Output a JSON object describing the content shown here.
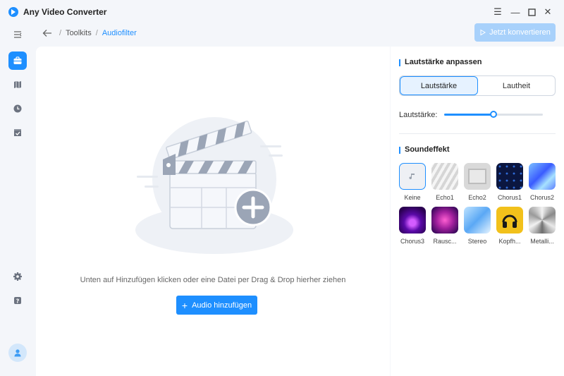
{
  "app": {
    "title": "Any Video Converter"
  },
  "breadcrumb": {
    "items": [
      "Toolkits",
      "Audiofilter"
    ]
  },
  "toolbar": {
    "convert_label": "Jetzt konvertieren"
  },
  "main": {
    "hint": "Unten auf Hinzufügen klicken oder eine Datei per Drag & Drop hierher ziehen",
    "add_button_label": "Audio hinzufügen"
  },
  "volume": {
    "section_title": "Lautstärke anpassen",
    "modes": [
      "Lautstärke",
      "Lautheit"
    ],
    "selected_mode": "Lautstärke",
    "slider_label": "Lautstärke:",
    "level": 0.5
  },
  "soundeffect": {
    "section_title": "Soundeffekt",
    "selected": "Keine",
    "items": [
      "Keine",
      "Echo1",
      "Echo2",
      "Chorus1",
      "Chorus2",
      "Chorus3",
      "Rausc...",
      "Stereo",
      "Kopfh...",
      "Metalli..."
    ]
  },
  "colors": {
    "accent": "#1e8fff",
    "accent_disabled": "#a8d1fb"
  },
  "icons": {
    "sidebar": [
      "menu-icon",
      "toolbox-icon",
      "map-icon",
      "clock-icon",
      "checklist-icon",
      "settings-icon",
      "help-icon",
      "avatar-icon"
    ]
  }
}
